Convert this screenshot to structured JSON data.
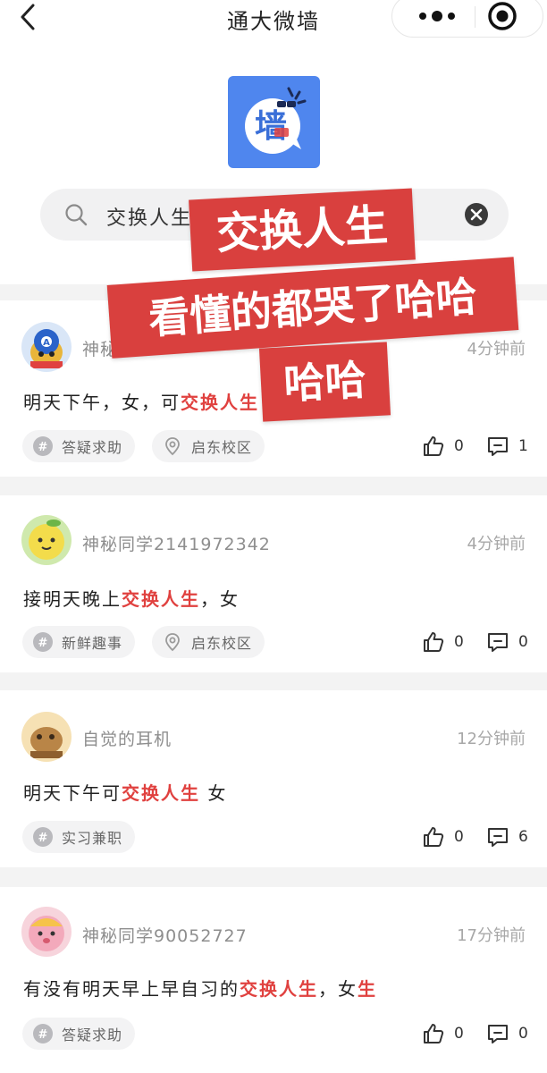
{
  "nav": {
    "title": "通大微墙"
  },
  "search": {
    "value": "交换人生"
  },
  "logo": {
    "char": "墙"
  },
  "overlay": {
    "line1": "交换人生",
    "line2": "看懂的都哭了哈哈",
    "line3": "哈哈"
  },
  "posts": [
    {
      "author": "神秘",
      "time": "4分钟前",
      "content_before": "明天下午，女，可",
      "content_highlight": "交换人生",
      "content_after": "",
      "tags": [
        "答疑求助",
        "启东校区"
      ],
      "likes": "0",
      "comments": "1"
    },
    {
      "author": "神秘同学2141972342",
      "time": "4分钟前",
      "content_before": "接明天晚上",
      "content_highlight": "交换人生",
      "content_after": "，女",
      "tags": [
        "新鲜趣事",
        "启东校区"
      ],
      "likes": "0",
      "comments": "0"
    },
    {
      "author": "自觉的耳机",
      "time": "12分钟前",
      "content_before": "明天下午可",
      "content_highlight": "交换人生",
      "content_after": " 女",
      "tags": [
        "实习兼职"
      ],
      "likes": "0",
      "comments": "6"
    },
    {
      "author": "神秘同学90052727",
      "time": "17分钟前",
      "content_before": "有没有明天早上早自习的",
      "content_highlight": "交换人生",
      "content_after": "，女",
      "content_highlight2": "生",
      "tags": [
        "答疑求助"
      ],
      "likes": "0",
      "comments": "0"
    }
  ],
  "colors": {
    "accent": "#4f86ee",
    "highlight": "#e0413f",
    "sticker": "#d9403e"
  },
  "icons": [
    "back-icon",
    "more-dots-icon",
    "target-icon",
    "search-icon",
    "clear-icon",
    "hashtag-icon",
    "location-icon",
    "thumbs-up-icon",
    "comment-icon"
  ]
}
